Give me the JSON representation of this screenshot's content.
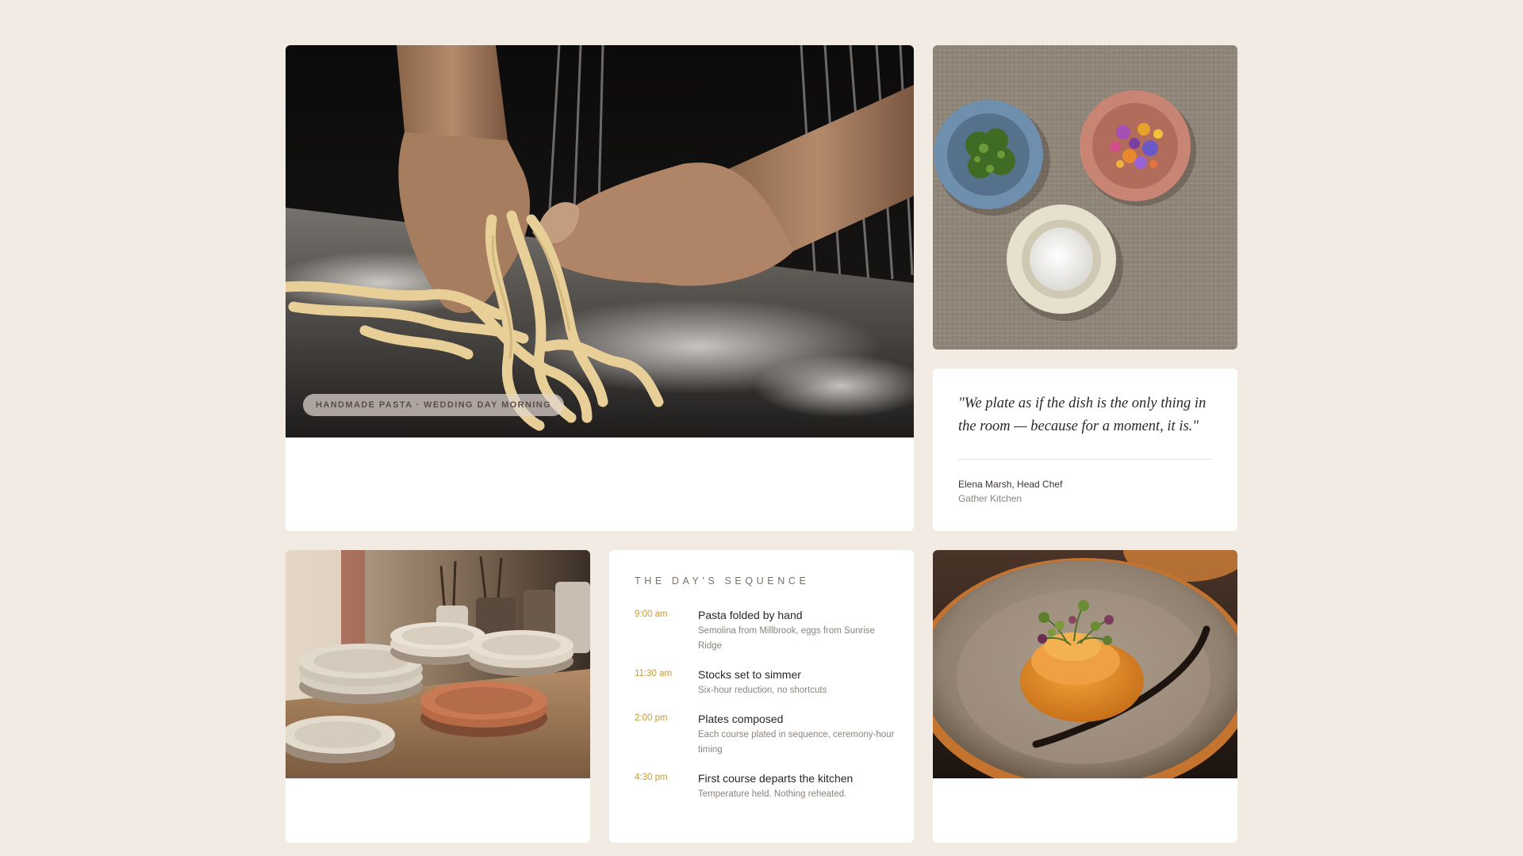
{
  "hero": {
    "caption": "HANDMADE PASTA · WEDDING DAY MORNING"
  },
  "quote": {
    "text": "\"We plate as if the dish is the only thing in the room — because for a moment, it is.\"",
    "author": "Elena Marsh, Head Chef",
    "organization": "Gather Kitchen"
  },
  "sequence": {
    "heading": "THE DAY'S SEQUENCE",
    "items": [
      {
        "time": "9:00 am",
        "title": "Pasta folded by hand",
        "description": "Semolina from Millbrook, eggs from Sunrise Ridge"
      },
      {
        "time": "11:30 am",
        "title": "Stocks set to simmer",
        "description": "Six-hour reduction, no shortcuts"
      },
      {
        "time": "2:00 pm",
        "title": "Plates composed",
        "description": "Each course plated in sequence, ceremony-hour timing"
      },
      {
        "time": "4:30 pm",
        "title": "First course departs the kitchen",
        "description": "Temperature held. Nothing reheated."
      }
    ]
  },
  "colors": {
    "page_background": "#f2ebe3",
    "card_background": "#ffffff",
    "time_accent": "#c29a3a"
  }
}
